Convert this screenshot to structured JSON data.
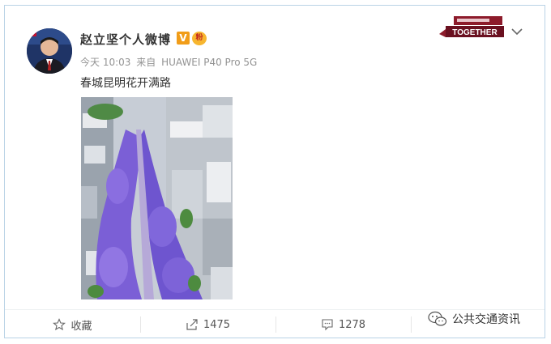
{
  "post": {
    "author": "赵立坚个人微博",
    "verified_badge": "V",
    "member_badge": "粉",
    "meta": {
      "time": "今天 10:03",
      "source_prefix": "来自",
      "source": "HUAWEI P40 Pro 5G"
    },
    "content": "春城昆明花开满路",
    "image_icon": "jacaranda-street-photo",
    "logo_text": "TOGETHER"
  },
  "toolbar": {
    "favorite": {
      "label": "收藏",
      "icon": "star-icon"
    },
    "repost": {
      "count": "1475",
      "icon": "repost-icon"
    },
    "comment": {
      "count": "1278",
      "icon": "comment-icon"
    }
  },
  "watermark": {
    "text": "公共交通资讯"
  },
  "colors": {
    "accent_badge": "#f19d19",
    "jacaranda": "#7b5fd6",
    "border": "#b9d3e6"
  }
}
